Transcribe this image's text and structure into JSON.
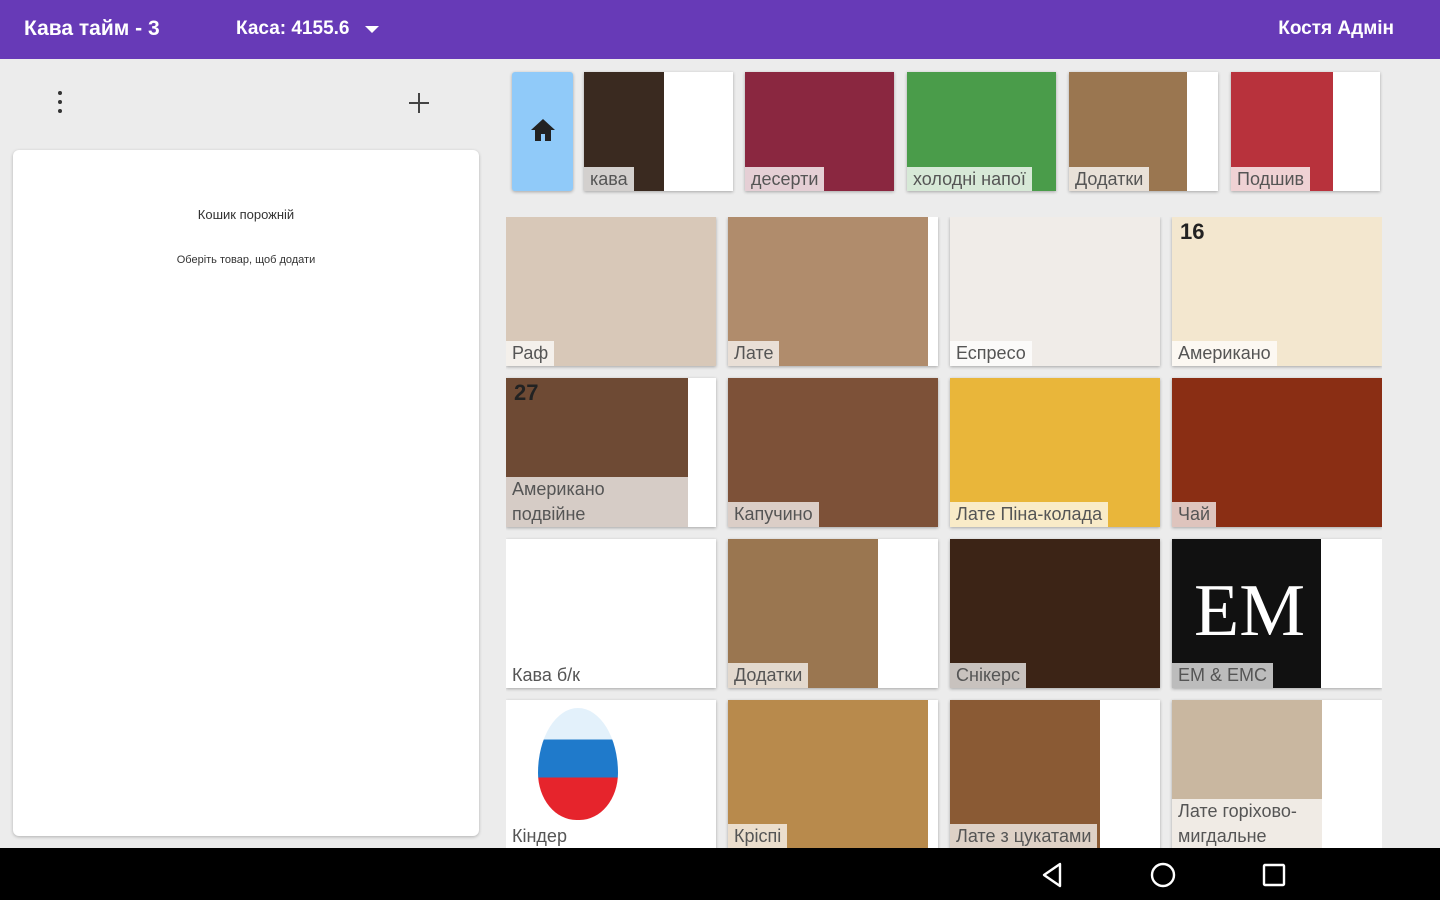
{
  "appbar": {
    "title": "Кава тайм - 3",
    "cash": "Каса: 4155.6",
    "user": "Костя Адмін",
    "color": "#673ab7"
  },
  "cart": {
    "empty_text": "Кошик порожній",
    "hint_text": "Оберіть товар, щоб додати"
  },
  "categories": [
    {
      "label": "кава",
      "image": "coffee-cup-image",
      "bg": "#3a2a20"
    },
    {
      "label": "десерти",
      "image": "dessert-image",
      "bg": "#8a2740"
    },
    {
      "label": "холодні напої",
      "image": "cold-drinks-image",
      "bg": "#4a9c4a"
    },
    {
      "label": "Додатки",
      "image": "sugar-box-image",
      "bg": "#9a7650"
    },
    {
      "label": "Подшив",
      "image": "sewing-image",
      "bg": "#b8323c"
    }
  ],
  "products": [
    {
      "label": "Раф",
      "image": "raf-image",
      "bg": "#d8c8b8"
    },
    {
      "label": "Лате",
      "image": "latte-image",
      "bg": "#b08c6c"
    },
    {
      "label": "Еспресо",
      "image": "espresso-image",
      "bg": "#f0ece8"
    },
    {
      "label": "Американо",
      "badge": "16",
      "image": "americano-image",
      "bg": "#f3e7cf"
    },
    {
      "label": "Американо подвійне",
      "badge": "27",
      "image": "double-americano-image",
      "bg": "#6e4a34"
    },
    {
      "label": "Капучино",
      "image": "cappuccino-image",
      "bg": "#7d5138"
    },
    {
      "label": "Лате Піна-колада",
      "image": "pina-colada-image",
      "bg": "#e9b63a"
    },
    {
      "label": "Чай",
      "image": "tea-image",
      "bg": "#8a2e14"
    },
    {
      "label": "Кава б/к",
      "image": "decaf-image",
      "bg": "#ffffff"
    },
    {
      "label": "Додатки",
      "image": "sugar-box-image",
      "bg": "#9a7650"
    },
    {
      "label": "Снікерс",
      "image": "snickers-image",
      "bg": "#3c2416"
    },
    {
      "label": "EM & EMC",
      "image": "em-logo-image",
      "bg": "#111111",
      "logo_text": "EM"
    },
    {
      "label": "Кіндер",
      "image": "kinder-egg-image",
      "bg": "#ffffff"
    },
    {
      "label": "Кріспі",
      "image": "crispy-bun-image",
      "bg": "#b88a4c"
    },
    {
      "label": "Лате з цукатами",
      "image": "latte-candied-image",
      "bg": "#8a5a34"
    },
    {
      "label": "Лате горіхово-мигдальне",
      "image": "latte-nut-image",
      "bg": "#c9b7a0"
    }
  ],
  "navbar": {
    "back": "back-icon",
    "home": "home-circle-icon",
    "recents": "recents-icon"
  }
}
